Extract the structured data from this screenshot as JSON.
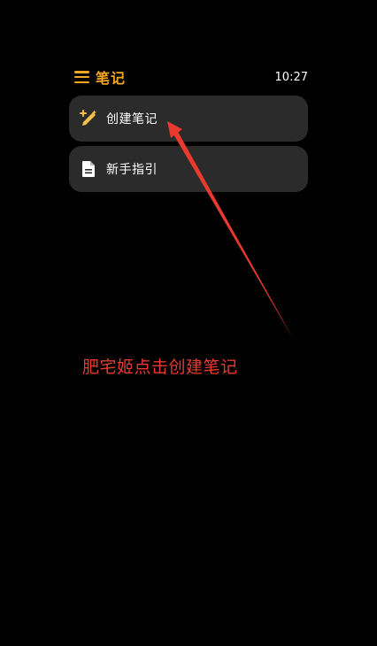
{
  "header": {
    "menu_icon": "menu-icon",
    "title": "笔记",
    "time": "10:27",
    "accent_color": "#f5a623"
  },
  "menu": {
    "items": [
      {
        "label": "创建笔记",
        "icon": "magic-pen-icon"
      },
      {
        "label": "新手指引",
        "icon": "document-icon"
      }
    ]
  },
  "annotation": {
    "text": "肥宅姬点击创建笔记",
    "color": "#e83a2e"
  }
}
